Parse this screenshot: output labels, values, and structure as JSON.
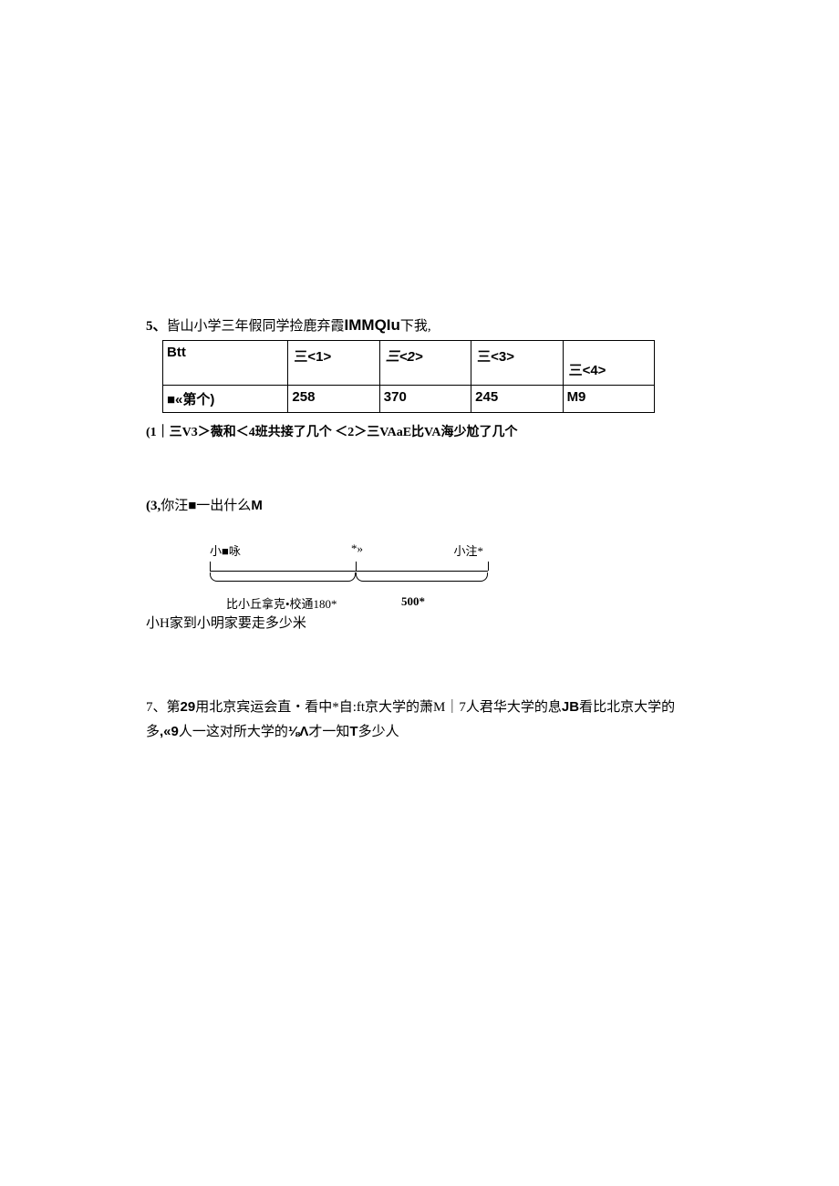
{
  "q5": {
    "num": "5、",
    "title_a": "皆山小学三年假同学捡鹿弃霞",
    "title_b": "IMMQIu",
    "title_c": "下我,",
    "table": {
      "r0c0": "Btt",
      "r0c1": "三<1>",
      "r0c2": "三<2>",
      "r0c3": "三<3>",
      "r0c4_bot": "三<4>",
      "r1c0": "■«第个)",
      "r1c1": "258",
      "r1c2": "370",
      "r1c3": "245",
      "r1c4": "M9"
    },
    "sub": "(1｜三V3＞薇和＜4班共接了几个  ＜2＞三VAaE比VA海少尬了几个"
  },
  "q3": {
    "num": "(3,",
    "text_a": "你汪■一出什么",
    "text_b": "M"
  },
  "diagram": {
    "top_left": "小■咏",
    "top_mid": "*»",
    "top_right": "小注*",
    "bot_left": "比小丘拿克•校通180*",
    "bot_right": "500*"
  },
  "q6": {
    "text": "小H家到小明家要走多少米"
  },
  "q7": {
    "num": "7、",
    "line1_a": "第",
    "line1_b": "29",
    "line1_c": "用北京宾运会直・看中*自:ft京大学的萧M｜7人君华大学的息",
    "line1_d": "JB",
    "line1_e": "看比北京大学的",
    "line2_a": "多",
    "line2_b": ",«9",
    "line2_c": "人一这对所大学的",
    "line2_d": "⅛Λ",
    "line2_e": "才一知",
    "line2_f": "T",
    "line2_g": "多少人"
  }
}
